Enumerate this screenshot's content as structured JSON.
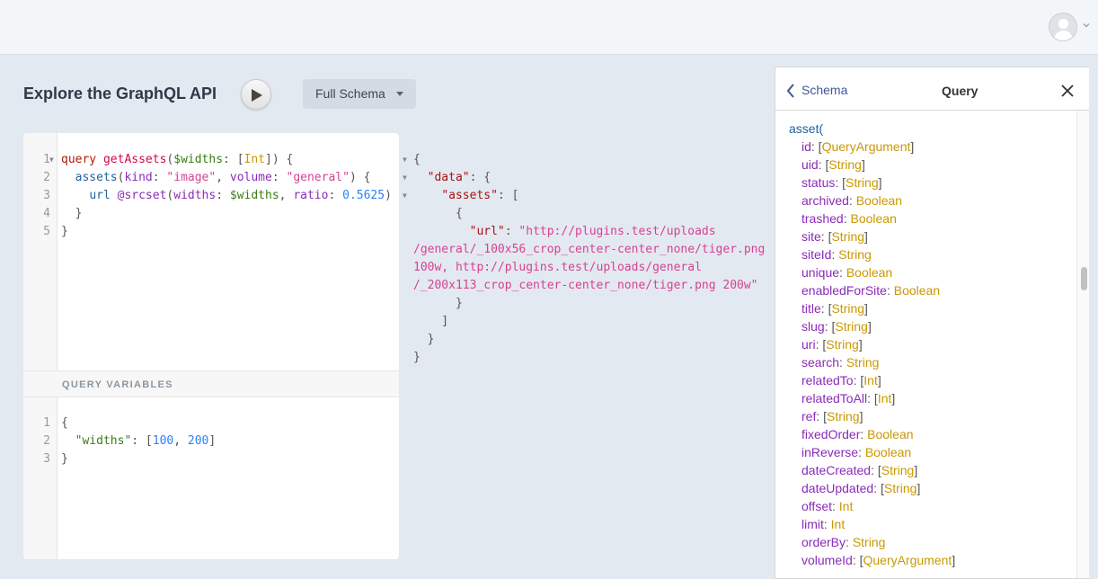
{
  "header": {
    "avatar_icon": "user-avatar-icon",
    "menu_icon": "chevron-down-icon"
  },
  "toolbar": {
    "title": "Explore the GraphQL API",
    "play_icon": "play-icon",
    "schema_label": "Full Schema"
  },
  "editor": {
    "query_lines": [
      [
        [
          "kw",
          "query"
        ],
        [
          "pn",
          " "
        ],
        [
          "def",
          "getAssets"
        ],
        [
          "pn",
          "("
        ],
        [
          "var",
          "$widths"
        ],
        [
          "pn",
          ": ["
        ],
        [
          "typ",
          "Int"
        ],
        [
          "pn",
          "]) {"
        ]
      ],
      [
        [
          "pn",
          "  "
        ],
        [
          "fld",
          "assets"
        ],
        [
          "pn",
          "("
        ],
        [
          "arg",
          "kind"
        ],
        [
          "pn",
          ": "
        ],
        [
          "str",
          "\"image\""
        ],
        [
          "pn",
          ", "
        ],
        [
          "arg",
          "volume"
        ],
        [
          "pn",
          ": "
        ],
        [
          "str",
          "\"general\""
        ],
        [
          "pn",
          ") {"
        ]
      ],
      [
        [
          "pn",
          "    "
        ],
        [
          "fld",
          "url"
        ],
        [
          "pn",
          " "
        ],
        [
          "att",
          "@srcset"
        ],
        [
          "pn",
          "("
        ],
        [
          "arg",
          "widths"
        ],
        [
          "pn",
          ": "
        ],
        [
          "var",
          "$widths"
        ],
        [
          "pn",
          ", "
        ],
        [
          "arg",
          "ratio"
        ],
        [
          "pn",
          ": "
        ],
        [
          "num",
          "0.5625"
        ],
        [
          "pn",
          ")"
        ]
      ],
      [
        [
          "pn",
          "  }"
        ]
      ],
      [
        [
          "pn",
          "}"
        ]
      ]
    ],
    "variables_label": "QUERY VARIABLES",
    "variables_lines": [
      [
        [
          "pn",
          "{"
        ]
      ],
      [
        [
          "pn",
          "  "
        ],
        [
          "var",
          "\"widths\""
        ],
        [
          "pn",
          ": ["
        ],
        [
          "num",
          "100"
        ],
        [
          "pn",
          ", "
        ],
        [
          "num",
          "200"
        ],
        [
          "pn",
          "]"
        ]
      ],
      [
        [
          "pn",
          "}"
        ]
      ]
    ]
  },
  "result": {
    "lines": [
      [
        [
          "pn",
          "{"
        ]
      ],
      [
        [
          "pn",
          "  "
        ],
        [
          "rkey",
          "\"data\""
        ],
        [
          "pn",
          ": {"
        ]
      ],
      [
        [
          "pn",
          "    "
        ],
        [
          "rkey",
          "\"assets\""
        ],
        [
          "pn",
          ": ["
        ]
      ],
      [
        [
          "pn",
          "      {"
        ]
      ],
      [
        [
          "pn",
          "        "
        ],
        [
          "rkey",
          "\"url\""
        ],
        [
          "pn",
          ": "
        ],
        [
          "str",
          "\"http://plugins.test/uploads"
        ]
      ],
      [
        [
          "str",
          "/general/_100x56_crop_center-center_none/tiger.png"
        ]
      ],
      [
        [
          "str",
          "100w, http://plugins.test/uploads/general"
        ]
      ],
      [
        [
          "str",
          "/_200x113_crop_center-center_none/tiger.png 200w\""
        ]
      ],
      [
        [
          "pn",
          "      }"
        ]
      ],
      [
        [
          "pn",
          "    ]"
        ]
      ],
      [
        [
          "pn",
          "  }"
        ]
      ],
      [
        [
          "pn",
          "}"
        ]
      ]
    ]
  },
  "docs": {
    "back_label": "Schema",
    "back_icon": "chevron-left-icon",
    "title": "Query",
    "close_icon": "close-icon",
    "field_name": "asset(",
    "args": [
      {
        "name": "id",
        "type": "QueryArgument",
        "list": true
      },
      {
        "name": "uid",
        "type": "String",
        "list": true
      },
      {
        "name": "status",
        "type": "String",
        "list": true
      },
      {
        "name": "archived",
        "type": "Boolean",
        "list": false
      },
      {
        "name": "trashed",
        "type": "Boolean",
        "list": false
      },
      {
        "name": "site",
        "type": "String",
        "list": true
      },
      {
        "name": "siteId",
        "type": "String",
        "list": false
      },
      {
        "name": "unique",
        "type": "Boolean",
        "list": false
      },
      {
        "name": "enabledForSite",
        "type": "Boolean",
        "list": false
      },
      {
        "name": "title",
        "type": "String",
        "list": true
      },
      {
        "name": "slug",
        "type": "String",
        "list": true
      },
      {
        "name": "uri",
        "type": "String",
        "list": true
      },
      {
        "name": "search",
        "type": "String",
        "list": false
      },
      {
        "name": "relatedTo",
        "type": "Int",
        "list": true
      },
      {
        "name": "relatedToAll",
        "type": "Int",
        "list": true
      },
      {
        "name": "ref",
        "type": "String",
        "list": true
      },
      {
        "name": "fixedOrder",
        "type": "Boolean",
        "list": false
      },
      {
        "name": "inReverse",
        "type": "Boolean",
        "list": false
      },
      {
        "name": "dateCreated",
        "type": "String",
        "list": true
      },
      {
        "name": "dateUpdated",
        "type": "String",
        "list": true
      },
      {
        "name": "offset",
        "type": "Int",
        "list": false
      },
      {
        "name": "limit",
        "type": "Int",
        "list": false
      },
      {
        "name": "orderBy",
        "type": "String",
        "list": false
      },
      {
        "name": "volumeId",
        "type": "QueryArgument",
        "list": true
      }
    ]
  }
}
